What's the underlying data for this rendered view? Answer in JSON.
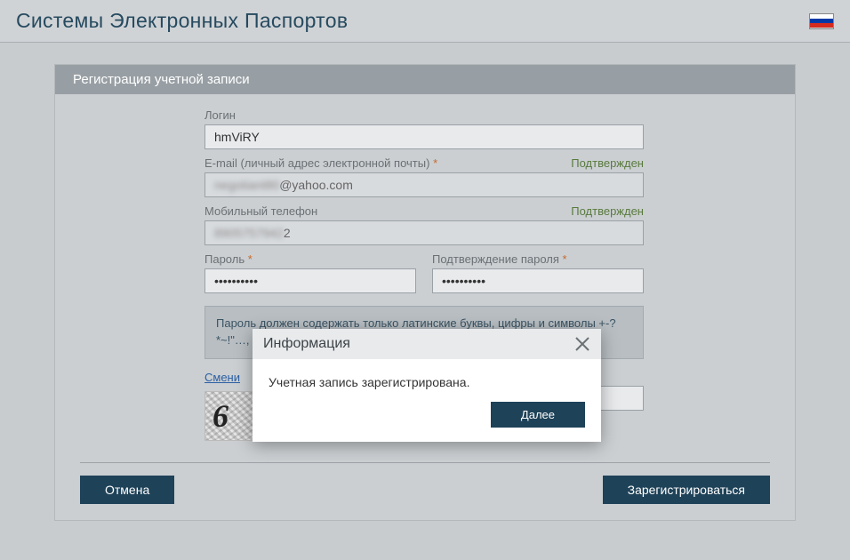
{
  "header": {
    "title": "Системы Электронных Паспортов",
    "flag": "russia"
  },
  "panel": {
    "title": "Регистрация учетной записи"
  },
  "form": {
    "login": {
      "label": "Логин",
      "value": "hmViRY"
    },
    "email": {
      "label": "E-mail (личный адрес электронной почты)",
      "req": "*",
      "confirmed": "Подтвержден",
      "value_prefix": "negotiant80",
      "value_suffix": "@yahoo.com"
    },
    "phone": {
      "label": "Мобильный телефон",
      "confirmed": "Подтвержден",
      "value_prefix": "8905757942",
      "value_suffix": "2"
    },
    "password": {
      "label": "Пароль",
      "req": "*",
      "value": "••••••••••"
    },
    "password2": {
      "label": "Подтверждение пароля",
      "req": "*",
      "value": "••••••••••"
    },
    "hint": "Пароль должен содержать только латинские буквы, цифры и символы +-?*~!\"…, которые …ва, одна с…",
    "captcha": {
      "link": "Смени",
      "img_text": "6",
      "field_label": "…",
      "req": "*"
    }
  },
  "buttons": {
    "cancel": "Отмена",
    "register": "Зарегистрироваться"
  },
  "modal": {
    "title": "Информация",
    "message": "Учетная запись зарегистрирована.",
    "next": "Далее"
  }
}
